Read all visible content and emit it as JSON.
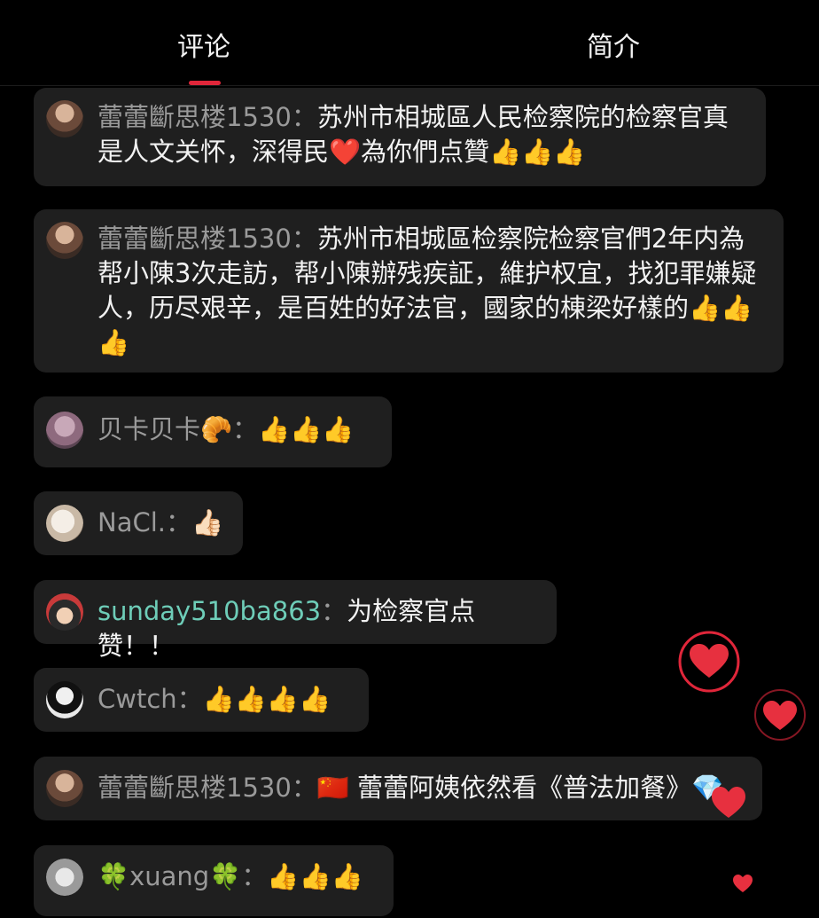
{
  "tabs": [
    {
      "label": "评论",
      "active": true
    },
    {
      "label": "简介",
      "active": false
    }
  ],
  "colors": {
    "accent": "#e0263a",
    "bubble_bg": "#1f1f1f",
    "username": "#9a9a9a",
    "username_teal": "#6ecdb8"
  },
  "comments": [
    {
      "user": "蕾蕾斷思楼1530",
      "sep": "：",
      "text": "苏州市相城區人民检察院的检察官真是人文关怀，深得民❤️為你們点贊👍👍👍"
    },
    {
      "user": "蕾蕾斷思楼1530",
      "sep": "：",
      "text": "苏州市相城區检察院检察官們2年内為帮小陳3次走訪，帮小陳辦残疾証，維护权宜，找犯罪嫌疑人，历尽艰辛，是百姓的好法官，國家的棟梁好樣的👍👍👍"
    },
    {
      "user": "贝卡贝卡🥐",
      "sep": "：",
      "text": "👍👍👍"
    },
    {
      "user": "NaCl.",
      "sep": "：",
      "text": "👍🏻"
    },
    {
      "user": "sunday510ba863",
      "sep": "：",
      "text": "为检察官点赞！！"
    },
    {
      "user": "Cwtch",
      "sep": "：",
      "text": "👍👍👍👍"
    },
    {
      "user": "蕾蕾斷思楼1530",
      "sep": "：",
      "text": "🇨🇳 蕾蕾阿姨依然看《普法加餐》💎"
    },
    {
      "user": "🍀xuang🍀",
      "sep": "：",
      "text": "👍👍👍"
    }
  ],
  "icons": {
    "like_float": "heart-icon",
    "gem": "gem-icon"
  }
}
